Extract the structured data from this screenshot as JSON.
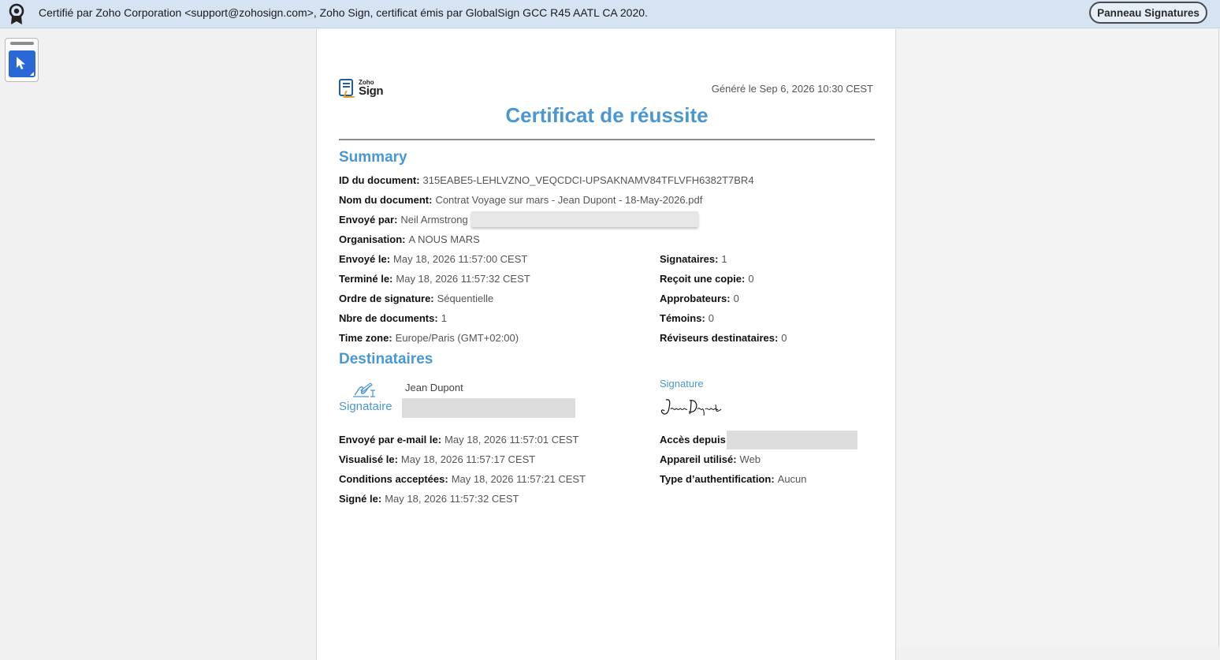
{
  "certbar": {
    "message": "Certifié par Zoho Corporation <support@zohosign.com>, Zoho Sign, certificat émis par GlobalSign GCC R45 AATL CA 2020.",
    "panel_button": "Panneau Signatures"
  },
  "document": {
    "logo_top": "Zoho",
    "logo_bottom": "Sign",
    "generated": "Généré le Sep 6, 2026 10:30 CEST",
    "title": "Certificat de réussite",
    "summary_heading": "Summary",
    "summary_left": [
      {
        "label": "ID du document:",
        "value": "315EABE5-LEHLVZNO_VEQCDCI-UPSAKNAMV84TFLVFH6382T7BR4"
      },
      {
        "label": "Nom du document:",
        "value": "Contrat Voyage sur mars - Jean Dupont - 18-May-2026.pdf"
      },
      {
        "label": "Envoyé par:",
        "value": "Neil Armstrong"
      },
      {
        "label": "Organisation:",
        "value": "A NOUS MARS"
      },
      {
        "label": "Envoyé le:",
        "value": "May 18, 2026 11:57:00 CEST"
      },
      {
        "label": "Terminé le:",
        "value": "May 18, 2026 11:57:32 CEST"
      },
      {
        "label": "Ordre de signature:",
        "value": "Séquentielle"
      },
      {
        "label": "Nbre de documents:",
        "value": "1"
      },
      {
        "label": "Time zone:",
        "value": "Europe/Paris (GMT+02:00)"
      }
    ],
    "summary_right": [
      {
        "label": "Signataires:",
        "value": "1"
      },
      {
        "label": "Reçoit une copie:",
        "value": "0"
      },
      {
        "label": "Approbateurs:",
        "value": "0"
      },
      {
        "label": "Témoins:",
        "value": "0"
      },
      {
        "label": "Réviseurs destinataires:",
        "value": "0"
      }
    ],
    "recipients_heading": "Destinataires",
    "signer_role": "Signataire",
    "signer_name": "Jean Dupont",
    "signature_label": "Signature",
    "recipient_left": [
      {
        "label": "Envoyé par e-mail le:",
        "value": "May 18, 2026 11:57:01 CEST"
      },
      {
        "label": "Visualisé le:",
        "value": "May 18, 2026 11:57:17 CEST"
      },
      {
        "label": "Conditions acceptées:",
        "value": "May 18, 2026 11:57:21 CEST"
      },
      {
        "label": "Signé le:",
        "value": "May 18, 2026 11:57:32 CEST"
      }
    ],
    "recipient_right": [
      {
        "label": "Accès depuis:",
        "value": ""
      },
      {
        "label": "Appareil utilisé:",
        "value": "Web"
      },
      {
        "label": "Type d’authentification:",
        "value": "Aucun"
      }
    ]
  },
  "colors": {
    "accent": "#4a97d2",
    "certbar_bg": "#d5e3f3",
    "tool_blue": "#2a68d6"
  },
  "icons": [
    "certificate-ribbon-icon",
    "pointer-select-icon",
    "zoho-sign-logo",
    "signer-pen-icon"
  ]
}
